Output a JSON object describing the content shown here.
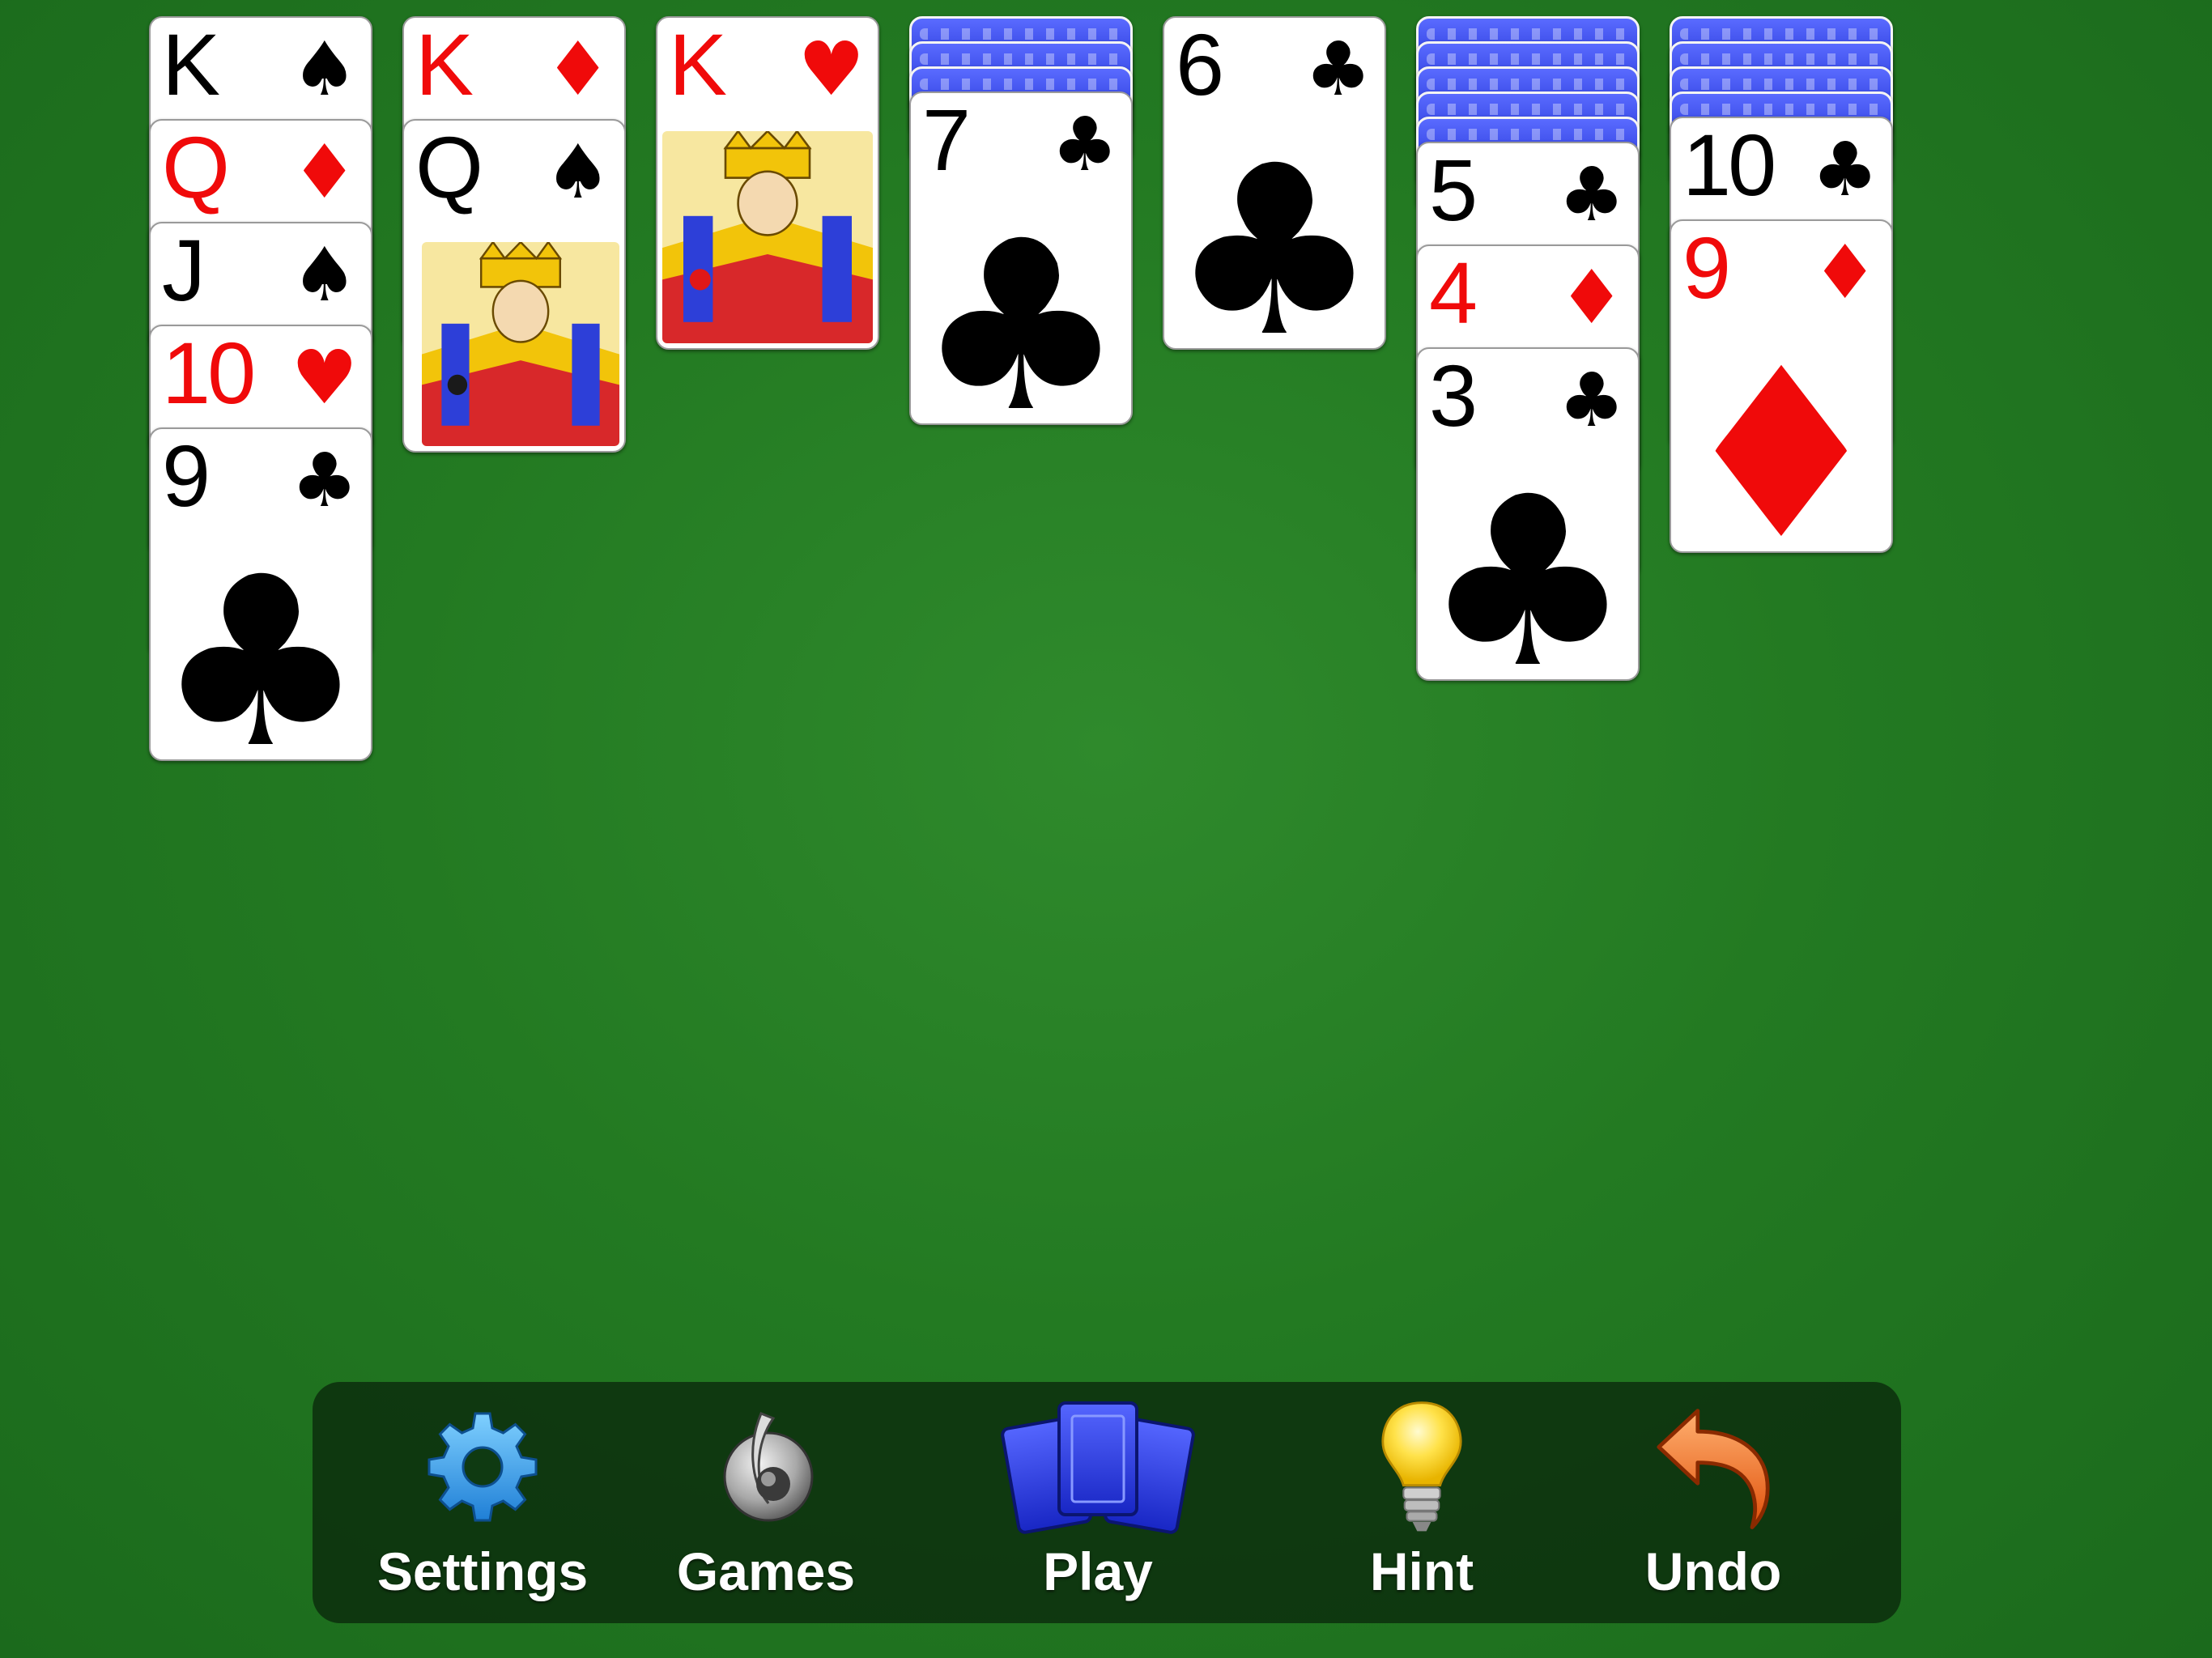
{
  "game": "Solitaire",
  "colors": {
    "felt": "#237a22",
    "red_suit": "#f00a0a",
    "black_suit": "#000000",
    "card_back": "#2233d6",
    "toolbar_bg": "#0a280c"
  },
  "tableau": [
    {
      "face_down_count": 0,
      "cards": [
        {
          "rank": "K",
          "suit": "♠",
          "color": "black"
        },
        {
          "rank": "Q",
          "suit": "♦",
          "color": "red"
        },
        {
          "rank": "J",
          "suit": "♠",
          "color": "black"
        },
        {
          "rank": "10",
          "suit": "♥",
          "color": "red"
        },
        {
          "rank": "9",
          "suit": "♣",
          "color": "black"
        }
      ]
    },
    {
      "face_down_count": 0,
      "cards": [
        {
          "rank": "K",
          "suit": "♦",
          "color": "red"
        },
        {
          "rank": "Q",
          "suit": "♠",
          "color": "black"
        }
      ]
    },
    {
      "face_down_count": 0,
      "cards": [
        {
          "rank": "K",
          "suit": "♥",
          "color": "red"
        }
      ]
    },
    {
      "face_down_count": 3,
      "cards": [
        {
          "rank": "7",
          "suit": "♣",
          "color": "black"
        }
      ]
    },
    {
      "face_down_count": 0,
      "cards": [
        {
          "rank": "6",
          "suit": "♣",
          "color": "black"
        }
      ]
    },
    {
      "face_down_count": 5,
      "cards": [
        {
          "rank": "5",
          "suit": "♣",
          "color": "black"
        },
        {
          "rank": "4",
          "suit": "♦",
          "color": "red"
        },
        {
          "rank": "3",
          "suit": "♣",
          "color": "black"
        }
      ]
    },
    {
      "face_down_count": 4,
      "cards": [
        {
          "rank": "10",
          "suit": "♣",
          "color": "black"
        },
        {
          "rank": "9",
          "suit": "♦",
          "color": "red"
        }
      ]
    }
  ],
  "toolbar": {
    "items": [
      {
        "id": "settings",
        "label": "Settings",
        "icon": "gear-icon"
      },
      {
        "id": "games",
        "label": "Games",
        "icon": "games-icon"
      },
      {
        "id": "play",
        "label": "Play",
        "icon": "cards-icon"
      },
      {
        "id": "hint",
        "label": "Hint",
        "icon": "lightbulb-icon"
      },
      {
        "id": "undo",
        "label": "Undo",
        "icon": "undo-arrow-icon"
      }
    ]
  }
}
